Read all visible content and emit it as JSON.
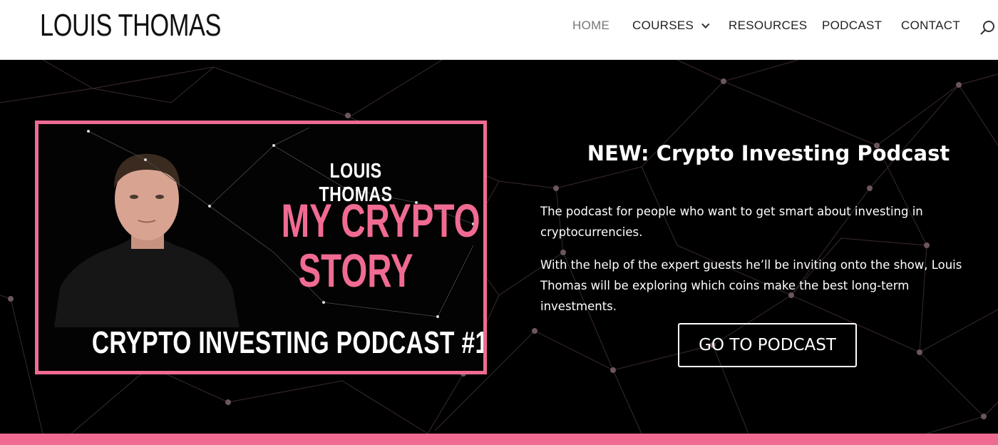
{
  "site": {
    "logo": "LOUIS THOMAS"
  },
  "nav": {
    "items": [
      {
        "label": "HOME",
        "active": true
      },
      {
        "label": "COURSES",
        "dropdown": true
      },
      {
        "label": "RESOURCES"
      },
      {
        "label": "PODCAST"
      },
      {
        "label": "CONTACT"
      }
    ],
    "search_icon": "search-icon"
  },
  "hero": {
    "promo": {
      "name": "LOUIS THOMAS",
      "title_line1": "MY CRYPTO",
      "title_line2": "STORY",
      "episode": "CRYPTO INVESTING PODCAST #1"
    },
    "heading": "NEW: Crypto Investing Podcast",
    "paragraph1": "The podcast for people who want to get smart about investing in cryptocurrencies.",
    "paragraph2": "With the help of the expert guests he’ll be inviting onto the show, Louis Thomas will be exploring which coins make the best long-term investments.",
    "cta_label": "GO TO PODCAST"
  },
  "colors": {
    "accent": "#f06b92",
    "background": "#000000",
    "header_bg": "#ffffff"
  }
}
